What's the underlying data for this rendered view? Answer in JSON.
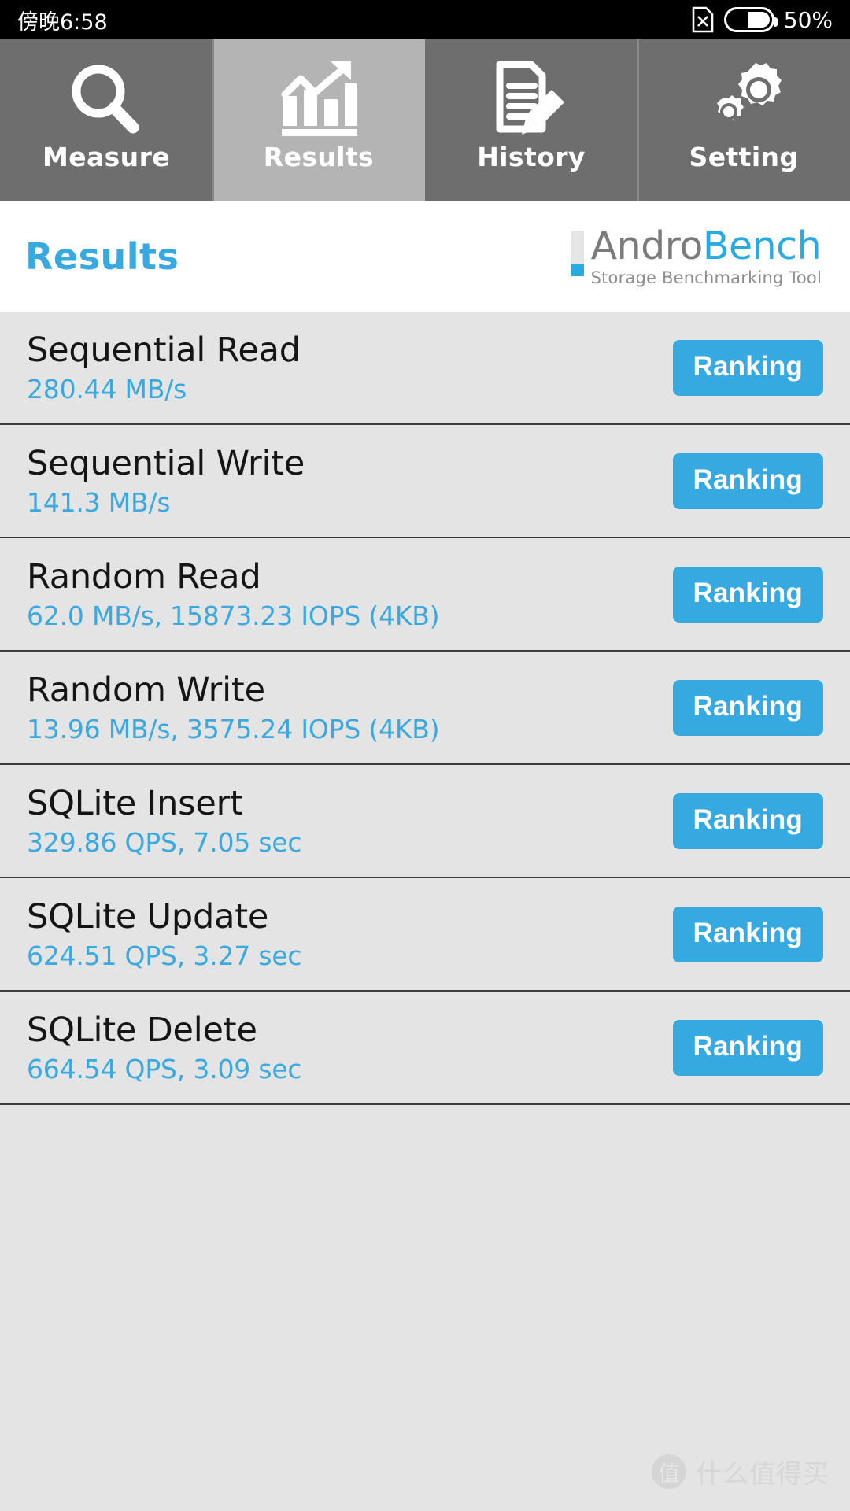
{
  "statusbar": {
    "clock": "傍晚6:58",
    "battery_percent": "50%",
    "sim_icon": "sim-x-icon",
    "battery_icon": "battery-half-icon"
  },
  "tabs": [
    {
      "label": "Measure",
      "icon": "magnifier-icon",
      "active": false
    },
    {
      "label": "Results",
      "icon": "bar-chart-arrow-icon",
      "active": true
    },
    {
      "label": "History",
      "icon": "document-pencil-icon",
      "active": false
    },
    {
      "label": "Setting",
      "icon": "gears-icon",
      "active": false
    }
  ],
  "header": {
    "title": "Results",
    "brand_first": "Andro",
    "brand_second": "Bench",
    "brand_subtitle": "Storage Benchmarking Tool"
  },
  "results": [
    {
      "title": "Sequential Read",
      "value": "280.44 MB/s",
      "button": "Ranking"
    },
    {
      "title": "Sequential Write",
      "value": "141.3 MB/s",
      "button": "Ranking"
    },
    {
      "title": "Random Read",
      "value": "62.0 MB/s, 15873.23 IOPS (4KB)",
      "button": "Ranking"
    },
    {
      "title": "Random Write",
      "value": "13.96 MB/s, 3575.24 IOPS (4KB)",
      "button": "Ranking"
    },
    {
      "title": "SQLite Insert",
      "value": "329.86 QPS, 7.05 sec",
      "button": "Ranking"
    },
    {
      "title": "SQLite Update",
      "value": "624.51 QPS, 3.27 sec",
      "button": "Ranking"
    },
    {
      "title": "SQLite Delete",
      "value": "664.54 QPS, 3.09 sec",
      "button": "Ranking"
    }
  ],
  "watermark": {
    "badge": "值",
    "text": "什么值得买"
  },
  "colors": {
    "accent_blue": "#36a9e1",
    "tab_inactive": "#6e6e6e",
    "tab_active": "#b4b4b4",
    "list_background": "#e4e4e4"
  }
}
